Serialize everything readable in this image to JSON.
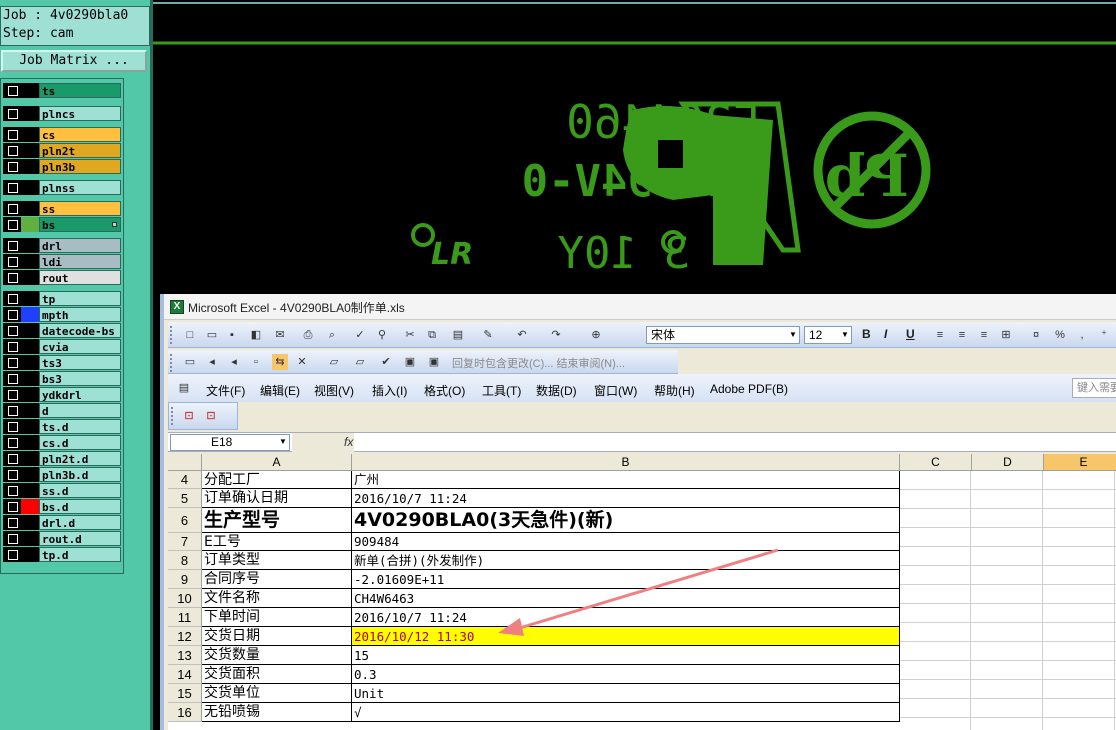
{
  "cam": {
    "job_label": "Job : 4v0290bla0",
    "step_label": "Step: cam",
    "job_matrix_button": "Job Matrix ...",
    "layers": [
      {
        "name": "ts",
        "color": "#1a9a6a",
        "active": false
      },
      {
        "name": "plncs",
        "color": "#9ee0d4",
        "active": false
      },
      {
        "name": "cs",
        "color": "#ffc040",
        "active": false
      },
      {
        "name": "pln2t",
        "color": "#e0a820",
        "active": false
      },
      {
        "name": "pln3b",
        "color": "#e0a820",
        "active": false
      },
      {
        "name": "plnss",
        "color": "#9ee0d4",
        "active": false
      },
      {
        "name": "ss",
        "color": "#ffc040",
        "active": false
      },
      {
        "name": "bs",
        "color": "#1a9a6a",
        "active": true,
        "swatch": "#60b040"
      },
      {
        "name": "drl",
        "color": "#a8bcc4",
        "active": false
      },
      {
        "name": "ldi",
        "color": "#a8bcc4",
        "active": false
      },
      {
        "name": "rout",
        "color": "#e0e0e0",
        "active": false
      },
      {
        "name": "tp",
        "color": "#9ee0d4",
        "active": false
      },
      {
        "name": "mpth",
        "color": "#9ee0d4",
        "active": false,
        "swatch": "#2040ff"
      },
      {
        "name": "datecode-bs",
        "color": "#9ee0d4",
        "active": false
      },
      {
        "name": "cvia",
        "color": "#9ee0d4",
        "active": false
      },
      {
        "name": "ts3",
        "color": "#9ee0d4",
        "active": false
      },
      {
        "name": "bs3",
        "color": "#9ee0d4",
        "active": false
      },
      {
        "name": "ydkdrl",
        "color": "#9ee0d4",
        "active": false
      },
      {
        "name": "d",
        "color": "#9ee0d4",
        "active": false
      },
      {
        "name": "ts.d",
        "color": "#9ee0d4",
        "active": false
      },
      {
        "name": "cs.d",
        "color": "#9ee0d4",
        "active": false
      },
      {
        "name": "pln2t.d",
        "color": "#9ee0d4",
        "active": false
      },
      {
        "name": "pln3b.d",
        "color": "#9ee0d4",
        "active": false
      },
      {
        "name": "ss.d",
        "color": "#9ee0d4",
        "active": false
      },
      {
        "name": "bs.d",
        "color": "#9ee0d4",
        "active": false,
        "swatch": "#ff0000"
      },
      {
        "name": "drl.d",
        "color": "#9ee0d4",
        "active": false
      },
      {
        "name": "rout.d",
        "color": "#9ee0d4",
        "active": false
      },
      {
        "name": "tp.d",
        "color": "#9ee0d4",
        "active": false
      }
    ],
    "artwork": {
      "line1": "E204460",
      "line2": "MII 94V-0",
      "line3": "3 10Y",
      "logo_text": "LR",
      "pb_text": "Pb",
      "color": "#3a9a1a"
    }
  },
  "excel": {
    "window_title": "Microsoft Excel - 4V0290BLA0制作单.xls",
    "font_name": "宋体",
    "font_size": "12",
    "review_text": "回复时包含更改(C)... 结束审阅(N)...",
    "menus": [
      "文件(F)",
      "编辑(E)",
      "视图(V)",
      "插入(I)",
      "格式(O)",
      "工具(T)",
      "数据(D)",
      "窗口(W)",
      "帮助(H)",
      "Adobe PDF(B)"
    ],
    "help_placeholder": "键入需要",
    "name_box": "E18",
    "fx_label": "fx",
    "columns": [
      "A",
      "B",
      "C",
      "D",
      "E"
    ],
    "rows": [
      {
        "num": "4",
        "a": "分配工厂",
        "b": "广州"
      },
      {
        "num": "5",
        "a": "订单确认日期",
        "b": "2016/10/7 11:24"
      },
      {
        "num": "6",
        "a": "生产型号",
        "b": "4V0290BLA0(3天急件)(新)"
      },
      {
        "num": "7",
        "a": "E工号",
        "b": "909484"
      },
      {
        "num": "8",
        "a": "订单类型",
        "b": "新单(合拼)(外发制作)"
      },
      {
        "num": "9",
        "a": "合同序号",
        "b": "-2.01609E+11"
      },
      {
        "num": "10",
        "a": "文件名称",
        "b": "CH4W6463"
      },
      {
        "num": "11",
        "a": "下单时间",
        "b": "2016/10/7 11:24"
      },
      {
        "num": "12",
        "a": "交货日期",
        "b": "2016/10/12 11:30"
      },
      {
        "num": "13",
        "a": "交货数量",
        "b": "15"
      },
      {
        "num": "14",
        "a": "交货面积",
        "b": "0.3"
      },
      {
        "num": "15",
        "a": "交货单位",
        "b": "Unit"
      },
      {
        "num": "16",
        "a": "无铅喷锡",
        "b": "√"
      }
    ],
    "highlight_color": "#ffff00",
    "arrow_color": "#f08080"
  }
}
